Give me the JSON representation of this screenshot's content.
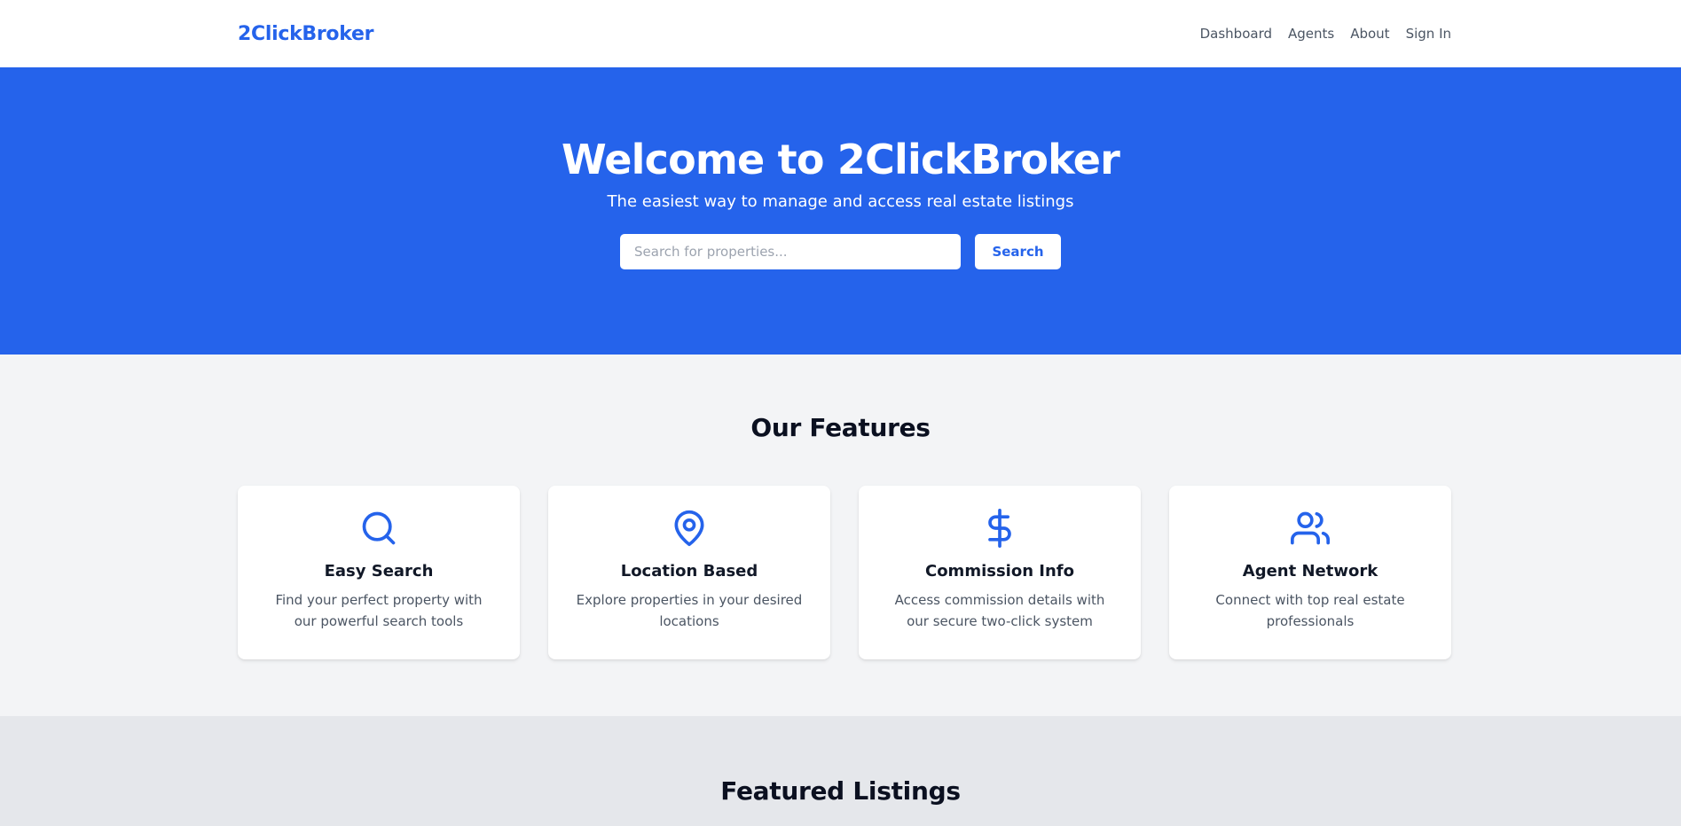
{
  "nav": {
    "logo": "2ClickBroker",
    "links": [
      "Dashboard",
      "Agents",
      "About",
      "Sign In"
    ]
  },
  "hero": {
    "title": "Welcome to 2ClickBroker",
    "subtitle": "The easiest way to manage and access real estate listings",
    "search_placeholder": "Search for properties...",
    "search_value": "",
    "search_button": "Search"
  },
  "features": {
    "title": "Our Features",
    "items": [
      {
        "icon": "search-icon",
        "title": "Easy Search",
        "description": "Find your perfect property with our powerful search tools"
      },
      {
        "icon": "map-pin-icon",
        "title": "Location Based",
        "description": "Explore properties in your desired locations"
      },
      {
        "icon": "dollar-icon",
        "title": "Commission Info",
        "description": "Access commission details with our secure two-click system"
      },
      {
        "icon": "users-icon",
        "title": "Agent Network",
        "description": "Connect with top real estate professionals"
      }
    ]
  },
  "listings": {
    "title": "Featured Listings"
  },
  "colors": {
    "brand": "#2563eb",
    "page_bg": "#f3f4f6",
    "listings_bg": "#e5e7eb",
    "text_muted": "#4b5563"
  }
}
